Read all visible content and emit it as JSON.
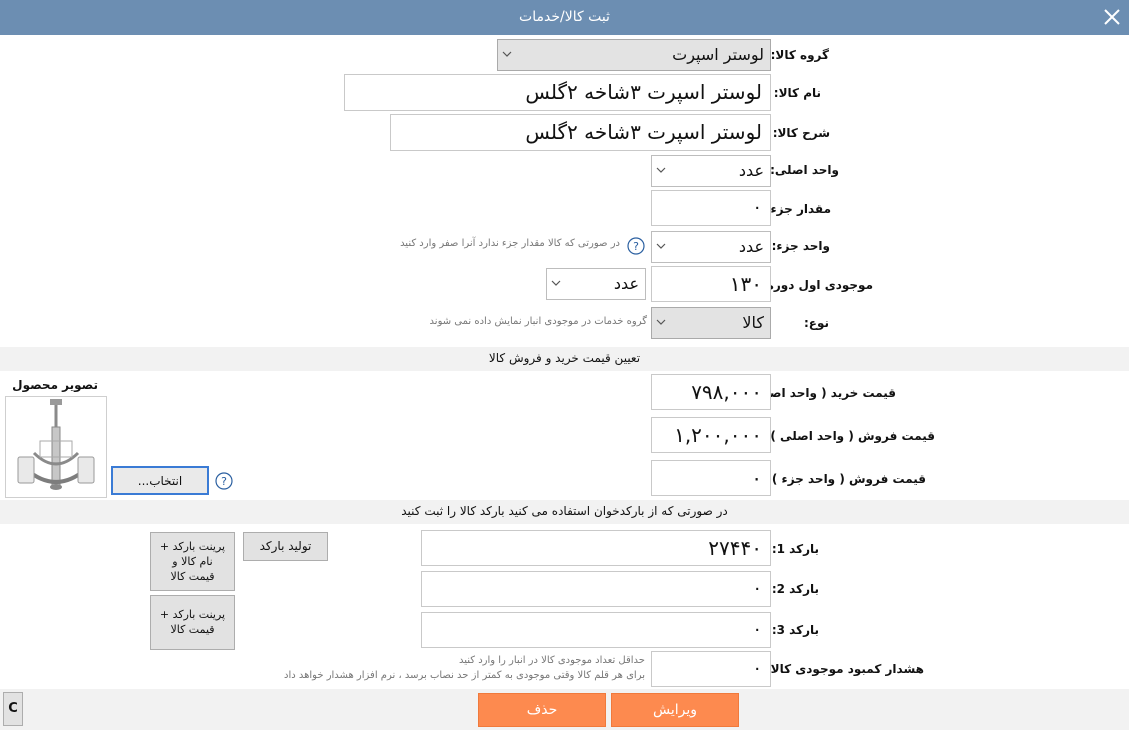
{
  "window": {
    "title": "ثبت کالا/خدمات"
  },
  "form": {
    "group": {
      "label": "گروه کالا:",
      "value": "لوستر اسپرت"
    },
    "name": {
      "label": "نام کالا:",
      "value": "لوستر اسپرت ۳شاخه ۲گلس"
    },
    "description": {
      "label": "شرح کالا:",
      "value": "لوستر اسپرت ۳شاخه ۲گلس"
    },
    "main_unit": {
      "label": "واحد اصلی:",
      "value": "عدد"
    },
    "part_amount": {
      "label": "مقدار جزء:",
      "value": "۰"
    },
    "part_unit": {
      "label": "واحد جزء:",
      "value": "عدد",
      "hint": "در صورتی که کالا مقدار جزء ندارد آنرا صفر وارد کنید"
    },
    "opening_stock": {
      "label": "موجودی اول دوره:",
      "value": "۱۳۰",
      "unit": "عدد"
    },
    "type": {
      "label": "نوع:",
      "value": "کالا",
      "hint": "گروه خدمات در موجودی انبار نمایش داده نمی شوند"
    }
  },
  "pricing": {
    "header": "تعیین قیمت خرید و فروش کالا",
    "purchase": {
      "label": "قیمت خرید ( واحد اصلی ) :",
      "value": "۷۹۸,۰۰۰"
    },
    "sale_main": {
      "label": "قیمت فروش ( واحد اصلی ) :",
      "value": "۱,۲۰۰,۰۰۰"
    },
    "sale_part": {
      "label": "قیمت فروش ( واحد جزء ) :",
      "value": "۰"
    }
  },
  "image": {
    "caption": "تصویر محصول",
    "choose_label": "انتخاب..."
  },
  "barcode": {
    "header": "در صورتی که از بارکدخوان استفاده می کنید بارکد کالا را ثبت کنید",
    "b1": {
      "label": "بارکد 1:",
      "value": "۲۷۴۴۰"
    },
    "b2": {
      "label": "بارکد 2:",
      "value": "۰"
    },
    "b3": {
      "label": "بارکد 3:",
      "value": "۰"
    },
    "generate_label": "تولید بارکد",
    "print1_label": "پرینت بارکد + نام کالا و قیمت کالا",
    "print2_label": "پرینت بارکد + قیمت کالا"
  },
  "warning": {
    "label": "هشدار کمبود موجودی کالا:",
    "value": "۰",
    "hint1": "حداقل تعداد موجودی کالا در انبار را وارد کنید",
    "hint2": "برای هر قلم کالا وقتی موجودی به کمتر از حد نصاب برسد ، نرم افزار هشدار خواهد داد"
  },
  "footer": {
    "edit_label": "ویرایش",
    "delete_label": "حذف",
    "c_label": "C"
  },
  "colors": {
    "titlebar": "#6c8eb2",
    "accent": "#fd8a4f",
    "band": "#f2f2f2"
  }
}
